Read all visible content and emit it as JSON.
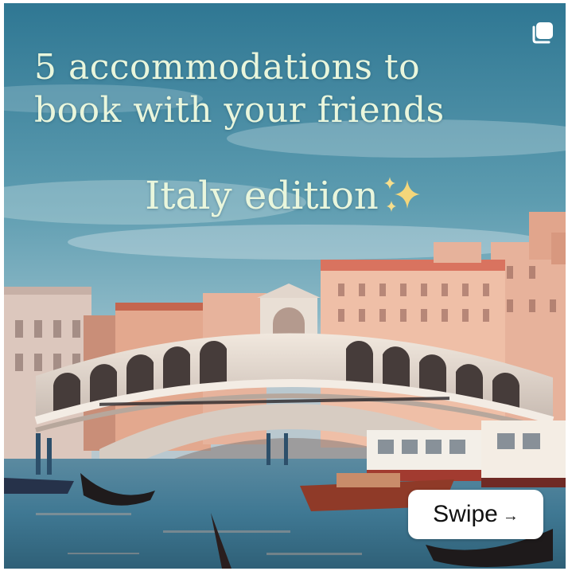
{
  "post": {
    "headline_line1": "5 accommodations to",
    "headline_line2": "book with your friends",
    "subhead": "Italy edition",
    "swipe_label": "Swipe",
    "swipe_arrow": "→",
    "icons": {
      "multi_image": "multiple-images-icon",
      "sparkles": "sparkles-icon",
      "swipe_arrow": "arrow-right-icon"
    }
  },
  "colors": {
    "sky": "#3d7d98",
    "text": "#e9f6dc",
    "sparkle": "#f4d67a",
    "water": "#4d88a3",
    "bridge": "#ece3da",
    "building_warm": "#e9a98c"
  }
}
